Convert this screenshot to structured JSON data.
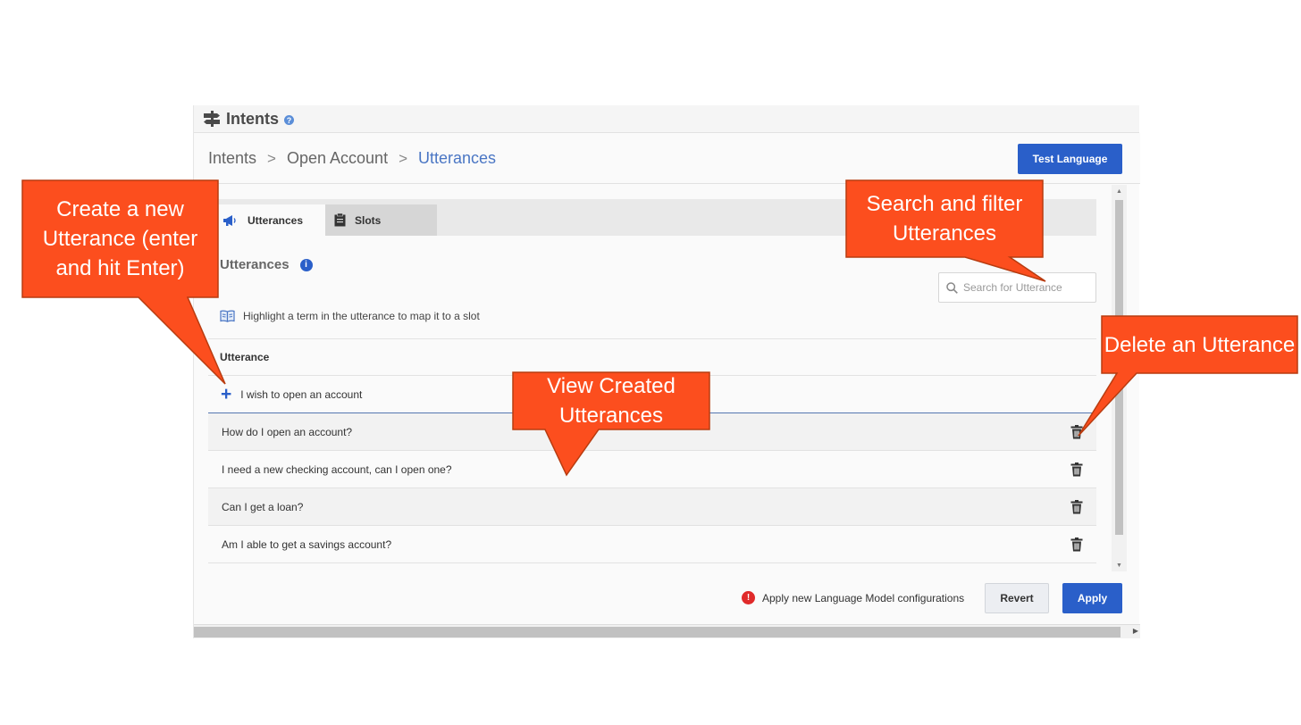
{
  "app": {
    "title": "Intents",
    "help_icon": "?"
  },
  "breadcrumb": {
    "items": [
      "Intents",
      "Open Account",
      "Utterances"
    ],
    "separator": ">"
  },
  "header": {
    "test_button": "Test Language"
  },
  "tabs": [
    {
      "label": "Utterances",
      "icon": "megaphone-icon",
      "active": true
    },
    {
      "label": "Slots",
      "icon": "clipboard-icon",
      "active": false
    }
  ],
  "section": {
    "title": "Utterances",
    "info_icon": "i"
  },
  "search": {
    "placeholder": "Search for Utterance"
  },
  "hint": "Highlight a term in the utterance to map it to a slot",
  "table": {
    "column_header": "Utterance",
    "new_input_value": "I wish to open an account",
    "rows": [
      "How do I open an account?",
      "I need a new checking account, can I open one?",
      "Can I get a loan?",
      "Am I able to get a savings account?"
    ]
  },
  "footer": {
    "warning_icon": "!",
    "warning": "Apply new Language Model configurations",
    "revert": "Revert",
    "apply": "Apply"
  },
  "callouts": {
    "create": "Create a new Utterance (enter and hit Enter)",
    "search": "Search and filter Utterances",
    "delete": "Delete an Utterance",
    "view": "View Created Utterances"
  },
  "colors": {
    "accent": "#2a5fc9",
    "callout_fill": "#fc4e1e",
    "callout_border": "#b83c10",
    "warning": "#e02a2a"
  }
}
